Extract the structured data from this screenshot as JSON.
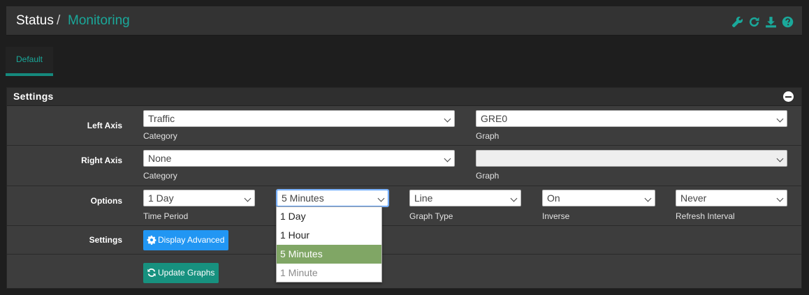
{
  "header": {
    "breadcrumb_root": "Status",
    "breadcrumb_sep": "/",
    "breadcrumb_current": "Monitoring",
    "icons": [
      "wrench-icon",
      "refresh-icon",
      "download-icon",
      "help-icon"
    ]
  },
  "tabs": [
    {
      "label": "Default",
      "active": true
    }
  ],
  "panel": {
    "title": "Settings",
    "rows": {
      "left_axis": {
        "label": "Left Axis",
        "category_value": "Traffic",
        "category_help": "Category",
        "graph_value": "GRE0",
        "graph_help": "Graph"
      },
      "right_axis": {
        "label": "Right Axis",
        "category_value": "None",
        "category_help": "Category",
        "graph_value": "",
        "graph_help": "Graph"
      },
      "options": {
        "label": "Options",
        "time_period_value": "1 Day",
        "time_period_help": "Time Period",
        "resolution_value": "5 Minutes",
        "graph_type_value": "Line",
        "graph_type_help": "Graph Type",
        "inverse_value": "On",
        "inverse_help": "Inverse",
        "refresh_value": "Never",
        "refresh_help": "Refresh Interval"
      },
      "settings": {
        "label": "Settings",
        "display_advanced": "Display Advanced"
      },
      "update": {
        "update_graphs": "Update Graphs"
      }
    }
  },
  "resolution_dropdown": {
    "options": [
      "1 Day",
      "1 Hour",
      "5 Minutes",
      "1 Minute"
    ],
    "selected": "5 Minutes"
  },
  "colors": {
    "accent": "#1aa89a",
    "tab_underline": "#15897d",
    "button_blue": "#2196f3",
    "button_teal": "#17917f",
    "dropdown_selected": "#80a665"
  }
}
